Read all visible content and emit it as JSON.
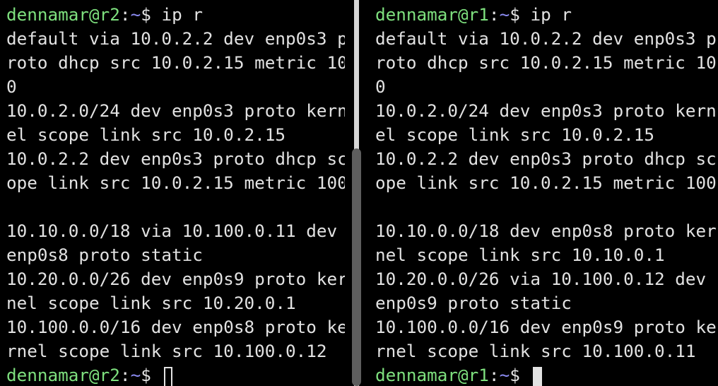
{
  "left_pane": {
    "prompt_user": "dennamar@r2",
    "prompt_sep": ":",
    "prompt_path": "~",
    "prompt_symbol": "$ ",
    "command": "ip r",
    "output": [
      "default via 10.0.2.2 dev enp0s3 p",
      "roto dhcp src 10.0.2.15 metric 10",
      "0",
      "10.0.2.0/24 dev enp0s3 proto kern",
      "el scope link src 10.0.2.15",
      "10.0.2.2 dev enp0s3 proto dhcp sc",
      "ope link src 10.0.2.15 metric 100",
      "",
      "10.10.0.0/18 via 10.100.0.11 dev",
      "enp0s8 proto static",
      "10.20.0.0/26 dev enp0s9 proto ker",
      "nel scope link src 10.20.0.1",
      "10.100.0.0/16 dev enp0s8 proto ke",
      "rnel scope link src 10.100.0.12"
    ],
    "final_prompt_user": "dennamar@r2",
    "final_prompt_symbol": "$"
  },
  "right_pane": {
    "prompt_user": "dennamar@r1",
    "prompt_sep": ":",
    "prompt_path": "~",
    "prompt_symbol": "$ ",
    "command": "ip r",
    "output": [
      "default via 10.0.2.2 dev enp0s3 p",
      "roto dhcp src 10.0.2.15 metric 10",
      "0",
      "10.0.2.0/24 dev enp0s3 proto kern",
      "el scope link src 10.0.2.15",
      "10.0.2.2 dev enp0s3 proto dhcp sc",
      "ope link src 10.0.2.15 metric 100",
      "",
      "10.10.0.0/18 dev enp0s8 proto ker",
      "nel scope link src 10.10.0.1",
      "10.20.0.0/26 via 10.100.0.12 dev",
      "enp0s9 proto static",
      "10.100.0.0/16 dev enp0s9 proto ke",
      "rnel scope link src 10.100.0.11"
    ],
    "final_prompt_user": "dennamar@r1",
    "final_prompt_symbol": "$"
  },
  "colors": {
    "background": "#000000",
    "text": "#e2e2e2",
    "prompt_user": "#7ee07e",
    "prompt_path": "#8b8bf2",
    "divider": "#d7d7d7",
    "scrollbar_thumb": "#5e5e5e"
  }
}
